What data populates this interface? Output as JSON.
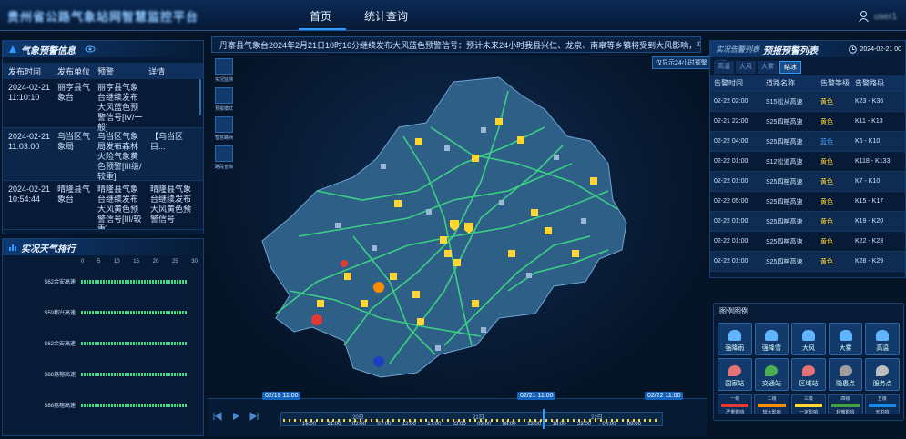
{
  "header": {
    "system_title": "贵州省公路气象站网智慧监控平台",
    "nav": [
      "首页",
      "统计查询"
    ],
    "user": "user1"
  },
  "warning_panel": {
    "title": "气象预警信息",
    "columns": [
      "发布时间",
      "发布单位",
      "预警",
      "详情"
    ],
    "rows": [
      {
        "time": "2024-02-21 11:10:10",
        "unit": "丽亨县气象台",
        "warning": "丽亨县气象台继续发布大风蓝色预警信号[IV/一般]",
        "detail": ""
      },
      {
        "time": "2024-02-21 11:03:00",
        "unit": "乌当区气象局",
        "warning": "乌当区气象局发布森林火险气象黄色预警[III级/较重]",
        "detail": "【乌当区目..."
      },
      {
        "time": "2024-02-21 10:54:44",
        "unit": "晴隆县气象台",
        "warning": "晴隆县气象台继续发布大风黄色预警信号[III/较重]",
        "detail": "晴隆县气象台继续发布大风黄色预警信号"
      }
    ]
  },
  "ticker": {
    "text": "丹寨县气象台2024年2月21日10时16分继续发布大风蓝色预警信号：预计未来24小时我县兴仁、龙泉、南皋等乡镇将受到大风影响，平均风力可达6级以上，..."
  },
  "map_tools": [
    "实况监测",
    "预报模式",
    "智慧路网",
    "路段查询"
  ],
  "toggle": {
    "label": "仅显示24小时预警"
  },
  "rank_panel": {
    "title": "实况天气排行",
    "scale": [
      "0",
      "5",
      "10",
      "15",
      "20",
      "25",
      "30"
    ],
    "rows": [
      {
        "name": "S62余安高速",
        "value": 28
      },
      {
        "name": "S50都兴高速",
        "value": 28
      },
      {
        "name": "S62余安高速",
        "value": 28
      },
      {
        "name": "S88荔榕高速",
        "value": 28
      },
      {
        "name": "S88荔榕高速",
        "value": 28
      }
    ]
  },
  "alert_panel": {
    "title": "预报预警列表",
    "subtitle": "实况告警列表",
    "date": "2024-02-21 00",
    "tabs": [
      "高温",
      "大风",
      "大雾",
      "结冰"
    ],
    "active_tab": "结冰",
    "columns": [
      "告警时间",
      "道路名称",
      "告警等级",
      "告警路段"
    ],
    "rows": [
      {
        "time": "02-22 02:00",
        "road": "S15松从高速",
        "level": "黄色",
        "seg": "K23 - K36"
      },
      {
        "time": "02-21 22:00",
        "road": "S25四榕高速",
        "level": "黄色",
        "seg": "K11 - K13"
      },
      {
        "time": "02-22 04:00",
        "road": "S25四榕高速",
        "level": "蓝色",
        "seg": "K6 - K10"
      },
      {
        "time": "02-22 01:00",
        "road": "S12松道高速",
        "level": "黄色",
        "seg": "K118 - K133"
      },
      {
        "time": "02-22 01:00",
        "road": "S25四榕高速",
        "level": "黄色",
        "seg": "K7 - K10"
      },
      {
        "time": "02-22 05:00",
        "road": "S25四榕高速",
        "level": "黄色",
        "seg": "K15 - K17"
      },
      {
        "time": "02-22 01:00",
        "road": "S25四榕高速",
        "level": "黄色",
        "seg": "K19 - K20"
      },
      {
        "time": "02-22 01:00",
        "road": "S25四榕高速",
        "level": "黄色",
        "seg": "K22 - K23"
      },
      {
        "time": "02-22 01:00",
        "road": "S25四榕高速",
        "level": "黄色",
        "seg": "K28 - K29"
      }
    ]
  },
  "legend": {
    "title": "图例图例",
    "items": [
      "强降雨",
      "强降雪",
      "大风",
      "大雾",
      "高温",
      "国家站",
      "交通站",
      "区域站",
      "隐患点",
      "服务点"
    ],
    "levels": [
      {
        "name": "一级",
        "desc": "严重影响",
        "color": "#e53935"
      },
      {
        "name": "二级",
        "desc": "较大影响",
        "color": "#fb8c00"
      },
      {
        "name": "三级",
        "desc": "一定影响",
        "color": "#fdd835"
      },
      {
        "name": "四级",
        "desc": "轻微影响",
        "color": "#43a047"
      },
      {
        "name": "五级",
        "desc": "无影响",
        "color": "#1e88e5"
      }
    ]
  },
  "timeline": {
    "start": "02/19 11:00",
    "current": "02/21 11:00",
    "end": "02/22 11:00",
    "days": [
      "20日",
      "21日",
      "22日"
    ],
    "hours": [
      "16:00",
      "21:00",
      "02:00",
      "07:00",
      "12:00",
      "17:00",
      "22:00",
      "03:00",
      "08:00",
      "13:00",
      "18:00",
      "23:00",
      "04:00",
      "09:00"
    ]
  },
  "colors": {
    "accent": "#2f9cff",
    "road": "#3ddc84",
    "warning": "#ffd633"
  }
}
